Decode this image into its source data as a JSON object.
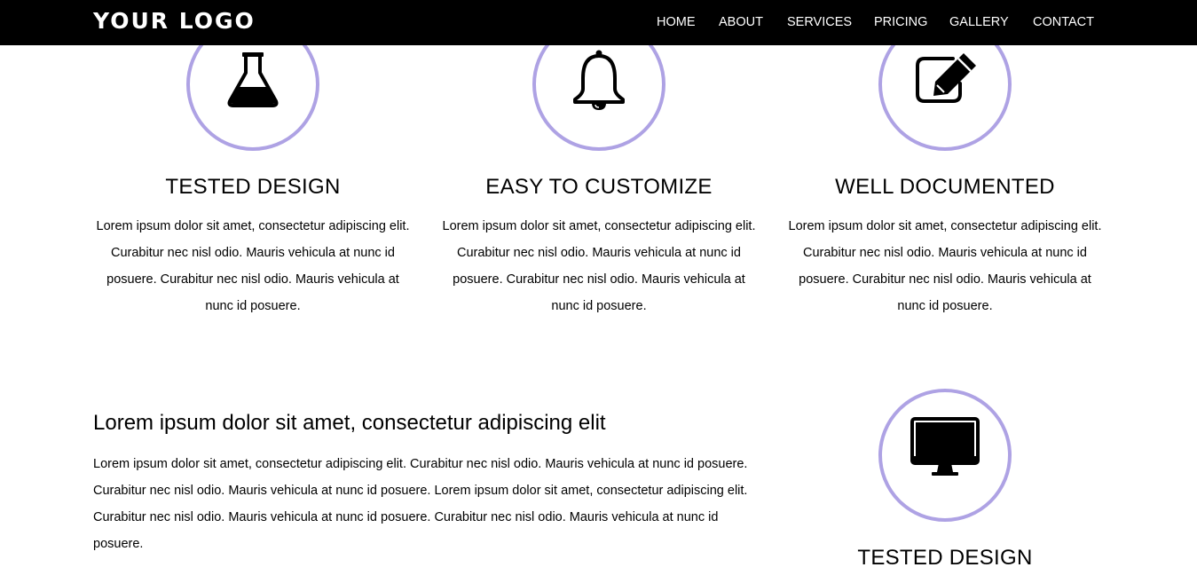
{
  "header": {
    "logo": "YOUR LOGO",
    "nav": [
      "HOME",
      "ABOUT",
      "SERVICES",
      "PRICING",
      "GALLERY",
      "CONTACT"
    ]
  },
  "features": [
    {
      "icon": "flask-icon",
      "title": "TESTED DESIGN",
      "text": "Lorem ipsum dolor sit amet, consectetur adipiscing elit. Curabitur nec nisl odio. Mauris vehicula at nunc id posuere. Curabitur nec nisl odio. Mauris vehicula at nunc id posuere."
    },
    {
      "icon": "bell-icon",
      "title": "EASY TO CUSTOMIZE",
      "text": "Lorem ipsum dolor sit amet, consectetur adipiscing elit. Curabitur nec nisl odio. Mauris vehicula at nunc id posuere. Curabitur nec nisl odio. Mauris vehicula at nunc id posuere."
    },
    {
      "icon": "edit-icon",
      "title": "WELL DOCUMENTED",
      "text": "Lorem ipsum dolor sit amet, consectetur adipiscing elit. Curabitur nec nisl odio. Mauris vehicula at nunc id posuere. Curabitur nec nisl odio. Mauris vehicula at nunc id posuere."
    }
  ],
  "about": {
    "heading": "Lorem ipsum dolor sit amet, consectetur adipiscing elit",
    "text": "Lorem ipsum dolor sit amet, consectetur adipiscing elit. Curabitur nec nisl odio. Mauris vehicula at nunc id posuere. Curabitur nec nisl odio. Mauris vehicula at nunc id posuere. Lorem ipsum dolor sit amet, consectetur adipiscing elit. Curabitur nec nisl odio. Mauris vehicula at nunc id posuere. Curabitur nec nisl odio. Mauris vehicula at nunc id posuere.",
    "feature": {
      "icon": "monitor-icon",
      "title": "TESTED DESIGN"
    }
  },
  "colors": {
    "navbar": "#000000",
    "circle_border": "#aea2e4",
    "text": "#000000"
  }
}
